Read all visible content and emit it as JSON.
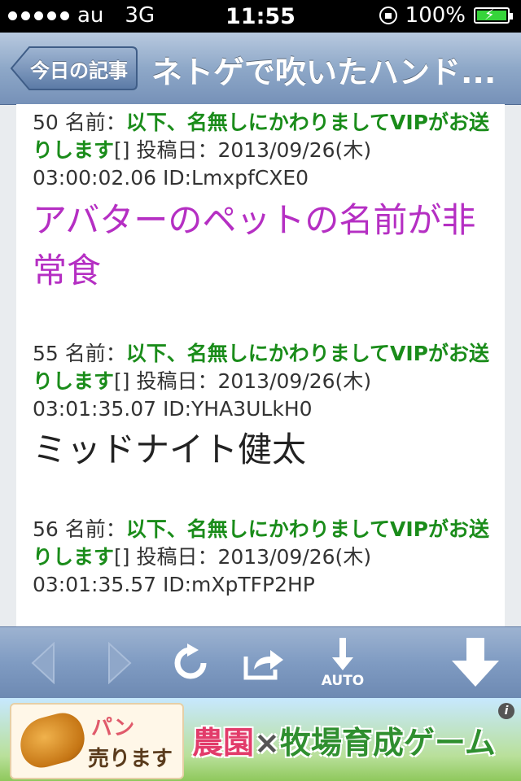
{
  "status_bar": {
    "carrier": "au",
    "network": "3G",
    "time": "11:55",
    "battery": "100%",
    "signal_bars": 5
  },
  "nav": {
    "back_label": "今日の記事",
    "title": "ネトゲで吹いたハンド..."
  },
  "posts": [
    {
      "number": "50",
      "name_label": "名前：",
      "name": "以下、名無しにかわりましてVIPがお送りします",
      "suffix": "[] 投稿日：2013/09/26(木) 03:00:02.06 ID:LmxpfCXE0",
      "body": "アバターのペットの名前が非常食",
      "body_color": "#b52fc3"
    },
    {
      "number": "55",
      "name_label": "名前：",
      "name": "以下、名無しにかわりましてVIPがお送りします",
      "suffix": "[] 投稿日：2013/09/26(木) 03:01:35.07 ID:YHA3ULkH0",
      "body": "ミッドナイト健太",
      "body_color": "#222222"
    },
    {
      "number": "56",
      "name_label": "名前：",
      "name": "以下、名無しにかわりましてVIPがお送りします",
      "suffix": "[] 投稿日：2013/09/26(木) 03:01:35.57 ID:mXpTFP2HP",
      "body": "",
      "body_color": "#222222"
    }
  ],
  "toolbar": {
    "back_icon": "chevron-left-icon",
    "forward_icon": "chevron-right-icon",
    "reload_icon": "reload-icon",
    "share_icon": "share-icon",
    "auto_label": "AUTO",
    "scroll_icon": "arrow-down-icon"
  },
  "ad": {
    "card_line1": "パン",
    "card_line2": "売ります",
    "headline_part1": "農園",
    "headline_sep": "×",
    "headline_part2": "牧場育成ゲーム",
    "info": "i"
  }
}
